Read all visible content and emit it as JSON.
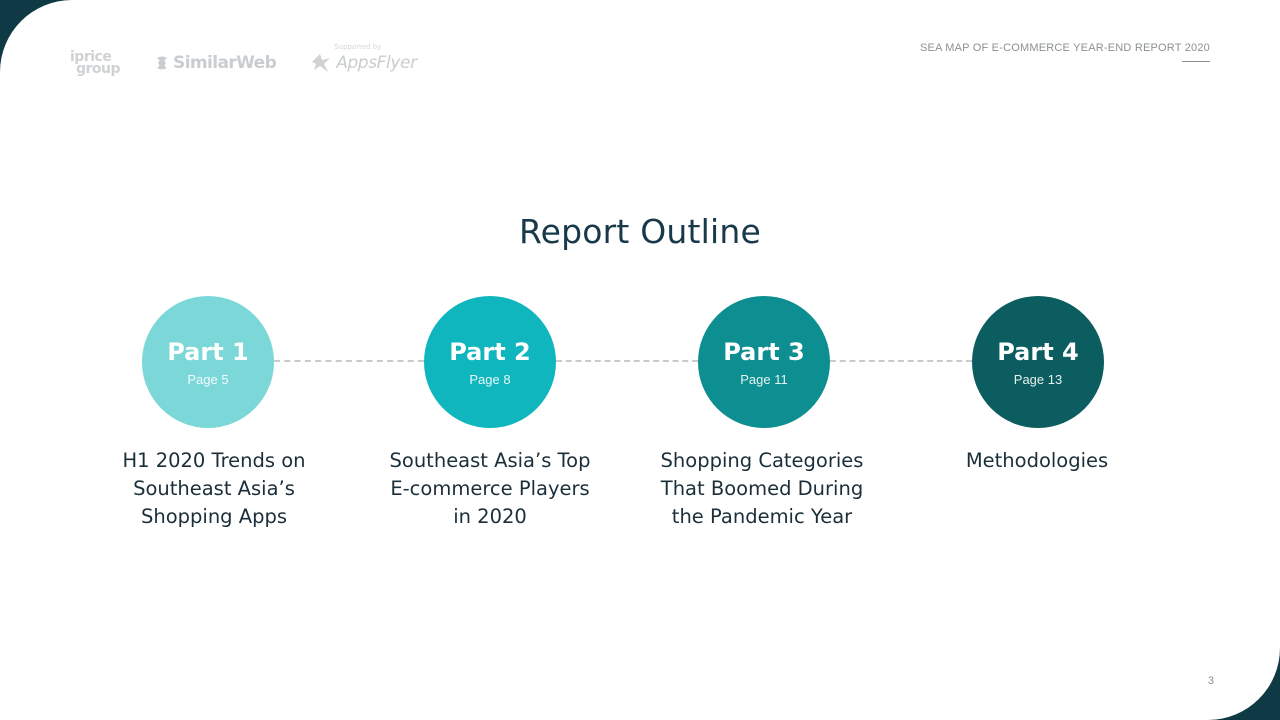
{
  "header": {
    "report_title": "SEA MAP OF E-COMMERCE YEAR-END REPORT 2020",
    "logos": [
      {
        "name": "iprice-group-logo",
        "text_line1": "iprice",
        "text_line2": "group"
      },
      {
        "name": "similarweb-logo",
        "text": "SimilarWeb"
      },
      {
        "name": "appsflyer-logo",
        "text": "AppsFlyer",
        "supported_by": "Supported by"
      }
    ]
  },
  "main": {
    "title": "Report Outline",
    "parts": [
      {
        "label": "Part 1",
        "page": "Page 5",
        "color": "#7cd8d8",
        "description": "H1 2020 Trends on Southeast Asia’s Shopping Apps"
      },
      {
        "label": "Part 2",
        "page": "Page 8",
        "color": "#0fb6bd",
        "description": "Southeast Asia’s Top E-commerce Players in 2020"
      },
      {
        "label": "Part 3",
        "page": "Page 11",
        "color": "#0d8e91",
        "description": "Shopping Categories That Boomed During the Pandemic Year"
      },
      {
        "label": "Part 4",
        "page": "Page 13",
        "color": "#0c5d5f",
        "description": "Methodologies"
      }
    ]
  },
  "footer": {
    "page_number": "3"
  },
  "colors": {
    "corner": "#0f3a45",
    "title": "#17394a",
    "connector": "#c7cbce"
  }
}
